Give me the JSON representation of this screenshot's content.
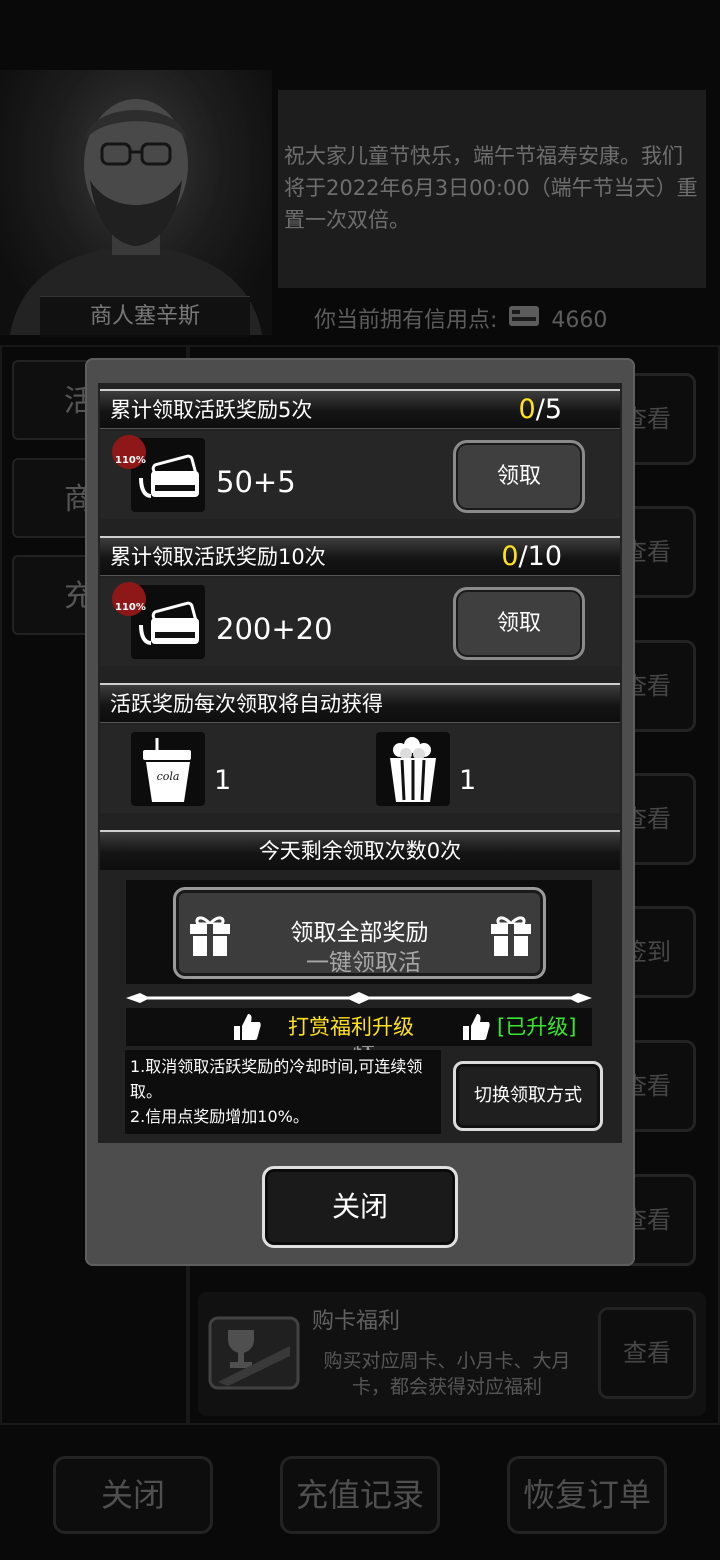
{
  "merchant": {
    "name": "商人塞辛斯",
    "speech": "祝大家儿童节快乐，端午节福寿安康。我们将于2022年6月3日00:00（端午节当天）重置一次双倍。"
  },
  "credits": {
    "label": "你当前拥有信用点:",
    "value": "4660"
  },
  "sidebar": {
    "tabs": [
      "活",
      "商",
      "充"
    ]
  },
  "list": {
    "view_label": "查看",
    "signin_label": "签到",
    "card_benefit": {
      "title": "购卡福利",
      "desc": "购买对应周卡、小月卡、大月卡，都会获得对应福利",
      "button": "查看"
    }
  },
  "bottom_buttons": {
    "close": "关闭",
    "recharge_record": "充值记录",
    "restore_order": "恢复订单"
  },
  "modal": {
    "reward1": {
      "title": "累计领取活跃奖励5次",
      "progress_done": "0",
      "progress_total": "/5",
      "amount": "50+5",
      "badge": "110%",
      "button": "领取"
    },
    "reward2": {
      "title": "累计领取活跃奖励10次",
      "progress_done": "0",
      "progress_total": "/10",
      "amount": "200+20",
      "badge": "110%",
      "button": "领取"
    },
    "auto": {
      "title": "活跃奖励每次领取将自动获得",
      "cola_label": "cola",
      "cola_count": "1",
      "popcorn_count": "1"
    },
    "remaining": "今天剩余领取次数0次",
    "claim_all": {
      "label": "领取全部奖励",
      "overlay": "一键领取活跃"
    },
    "upgrade": {
      "label": "打赏福利升级",
      "status": "[已升级]"
    },
    "desc": {
      "line1": "1.取消领取活跃奖励的冷却时间,可连续领取。",
      "line2": "2.信用点奖励增加10%。"
    },
    "switch_button": "切换领取方式",
    "close_button": "关闭"
  },
  "colors": {
    "accent_yellow": "#ffe21a",
    "status_green": "#38e82a",
    "badge_red": "#8e1717"
  }
}
